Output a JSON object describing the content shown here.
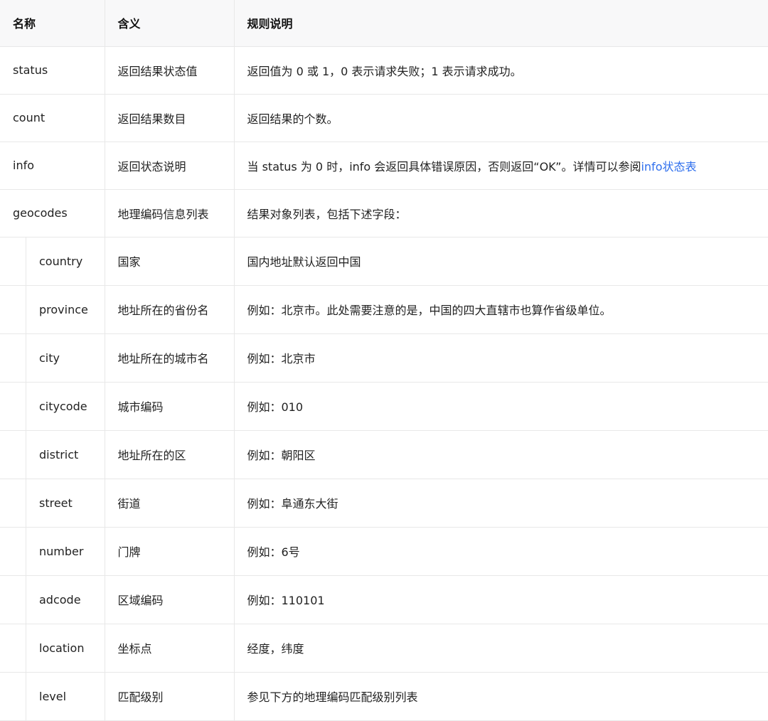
{
  "table": {
    "headers": {
      "name": "名称",
      "meaning": "含义",
      "rule": "规则说明"
    },
    "rows": [
      {
        "name": "status",
        "meaning": "返回结果状态值",
        "rule": "返回值为 0 或 1，0 表示请求失败；1 表示请求成功。"
      },
      {
        "name": "count",
        "meaning": "返回结果数目",
        "rule": "返回结果的个数。"
      },
      {
        "name": "info",
        "meaning": "返回状态说明",
        "rule": "当 status 为 0 时，info 会返回具体错误原因，否则返回“OK”。详情可以参阅",
        "link": "info状态表"
      },
      {
        "name": "geocodes",
        "meaning": "地理编码信息列表",
        "rule": "结果对象列表，包括下述字段："
      }
    ],
    "sub_rows": [
      {
        "name": "country",
        "meaning": "国家",
        "rule": "国内地址默认返回中国"
      },
      {
        "name": "province",
        "meaning": "地址所在的省份名",
        "rule": "例如：北京市。此处需要注意的是，中国的四大直辖市也算作省级单位。"
      },
      {
        "name": "city",
        "meaning": "地址所在的城市名",
        "rule": "例如：北京市"
      },
      {
        "name": "citycode",
        "meaning": "城市编码",
        "rule": "例如：010"
      },
      {
        "name": "district",
        "meaning": "地址所在的区",
        "rule": "例如：朝阳区"
      },
      {
        "name": "street",
        "meaning": "街道",
        "rule": "例如：阜通东大街"
      },
      {
        "name": "number",
        "meaning": "门牌",
        "rule": "例如：6号"
      },
      {
        "name": "adcode",
        "meaning": "区域编码",
        "rule": "例如：110101"
      },
      {
        "name": "location",
        "meaning": "坐标点",
        "rule": "经度，纬度"
      },
      {
        "name": "level",
        "meaning": "匹配级别",
        "rule": "参见下方的地理编码匹配级别列表"
      }
    ]
  },
  "colors": {
    "link": "#2f6fed",
    "header_bg": "#f8f8f9",
    "border": "#e8e8e8"
  }
}
